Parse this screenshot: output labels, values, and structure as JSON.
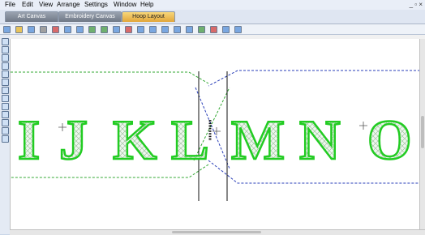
{
  "menu": {
    "items": [
      "File",
      "Edit",
      "View",
      "Arrange",
      "Settings",
      "Window",
      "Help"
    ]
  },
  "window_controls": "_ ▫ ×",
  "tabs": [
    {
      "label": "Art Canvas",
      "active": false
    },
    {
      "label": "Embroidery Canvas",
      "active": false
    },
    {
      "label": "Hoop Layout",
      "active": true
    }
  ],
  "canvas": {
    "letters": [
      "I",
      "J",
      "K",
      "L",
      "M",
      "N",
      "O"
    ]
  },
  "colors": {
    "letter_outline": "#22cc22",
    "letter_fill": "#d8f2d8",
    "hoop_left": "#33a833",
    "hoop_right": "#2a3fb8",
    "tab_active": "#e2a63a"
  },
  "icons": {
    "toolbar": [
      "new-icon",
      "open-icon",
      "save-icon",
      "print-icon",
      "cut-icon",
      "copy-icon",
      "paste-icon",
      "undo-icon",
      "redo-icon",
      "zoom-icon",
      "select-icon",
      "align-icon",
      "group-icon",
      "ungroup-icon",
      "grid-icon",
      "hoop-icon",
      "stitch-icon",
      "color-icon",
      "view-icon",
      "settings-icon"
    ],
    "sidebar": [
      "pointer-icon",
      "pan-icon",
      "zoom-in-icon",
      "zoom-out-icon",
      "rectangle-icon",
      "ellipse-icon",
      "text-icon",
      "line-icon",
      "pen-icon",
      "fill-icon",
      "hoop-icon",
      "stitch-icon",
      "layers-icon"
    ]
  }
}
